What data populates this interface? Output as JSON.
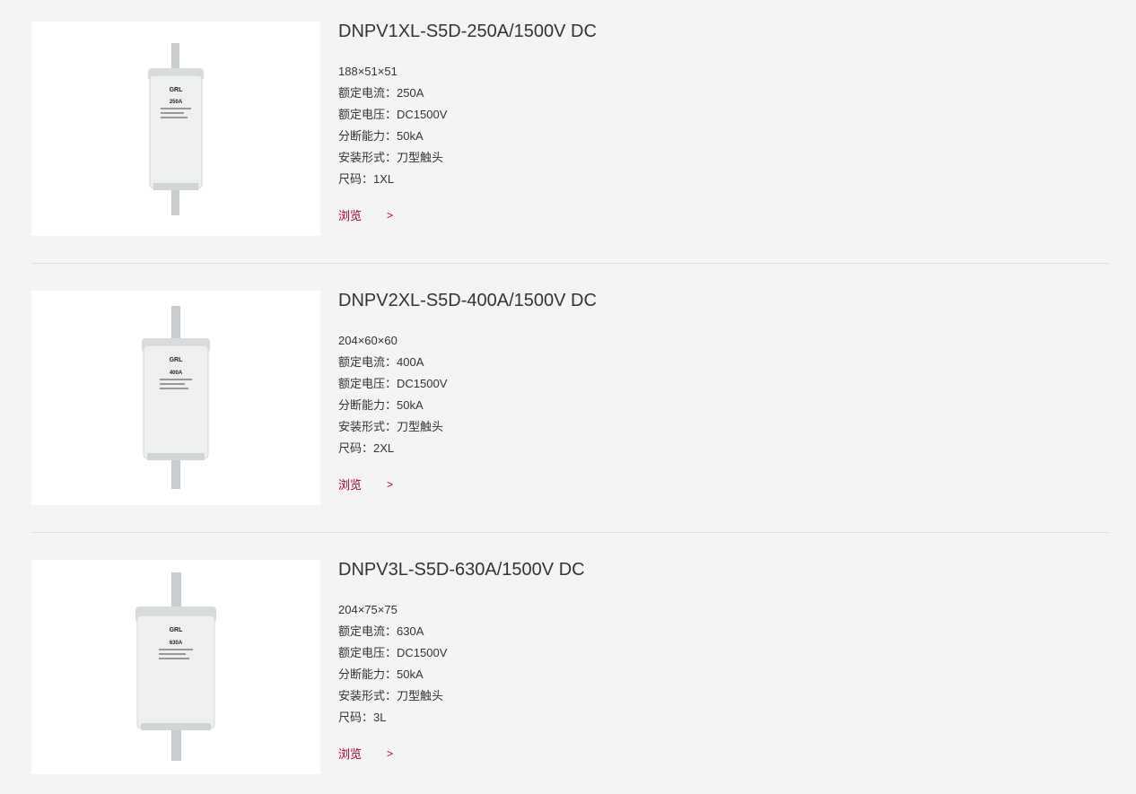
{
  "products": [
    {
      "title": "DNPV1XL-S5D-250A/1500V DC",
      "dimensions": "188×51×51",
      "rated_current": "额定电流：250A",
      "rated_voltage": "额定电压：DC1500V",
      "breaking_capacity": "分断能力：50kA",
      "mounting": "安装形式：刀型触头",
      "size": "尺码：1XL",
      "browse_label": "浏览",
      "arrow": ">",
      "fuse_label_brand": "GRL",
      "fuse_label_rating": "250A"
    },
    {
      "title": "DNPV2XL-S5D-400A/1500V DC",
      "dimensions": "204×60×60",
      "rated_current": "额定电流：400A",
      "rated_voltage": "额定电压：DC1500V",
      "breaking_capacity": "分断能力：50kA",
      "mounting": "安装形式：刀型触头",
      "size": "尺码：2XL",
      "browse_label": "浏览",
      "arrow": ">",
      "fuse_label_brand": "GRL",
      "fuse_label_rating": "400A"
    },
    {
      "title": "DNPV3L-S5D-630A/1500V DC",
      "dimensions": "204×75×75",
      "rated_current": "额定电流：630A",
      "rated_voltage": "额定电压：DC1500V",
      "breaking_capacity": "分断能力：50kA",
      "mounting": "安装形式：刀型触头",
      "size": "尺码：3L",
      "browse_label": "浏览",
      "arrow": ">",
      "fuse_label_brand": "GRL",
      "fuse_label_rating": "630A"
    }
  ],
  "colors": {
    "background": "#f4f4f4",
    "card": "#ffffff",
    "accent": "#a4002a",
    "divider": "#dcdcdc"
  }
}
